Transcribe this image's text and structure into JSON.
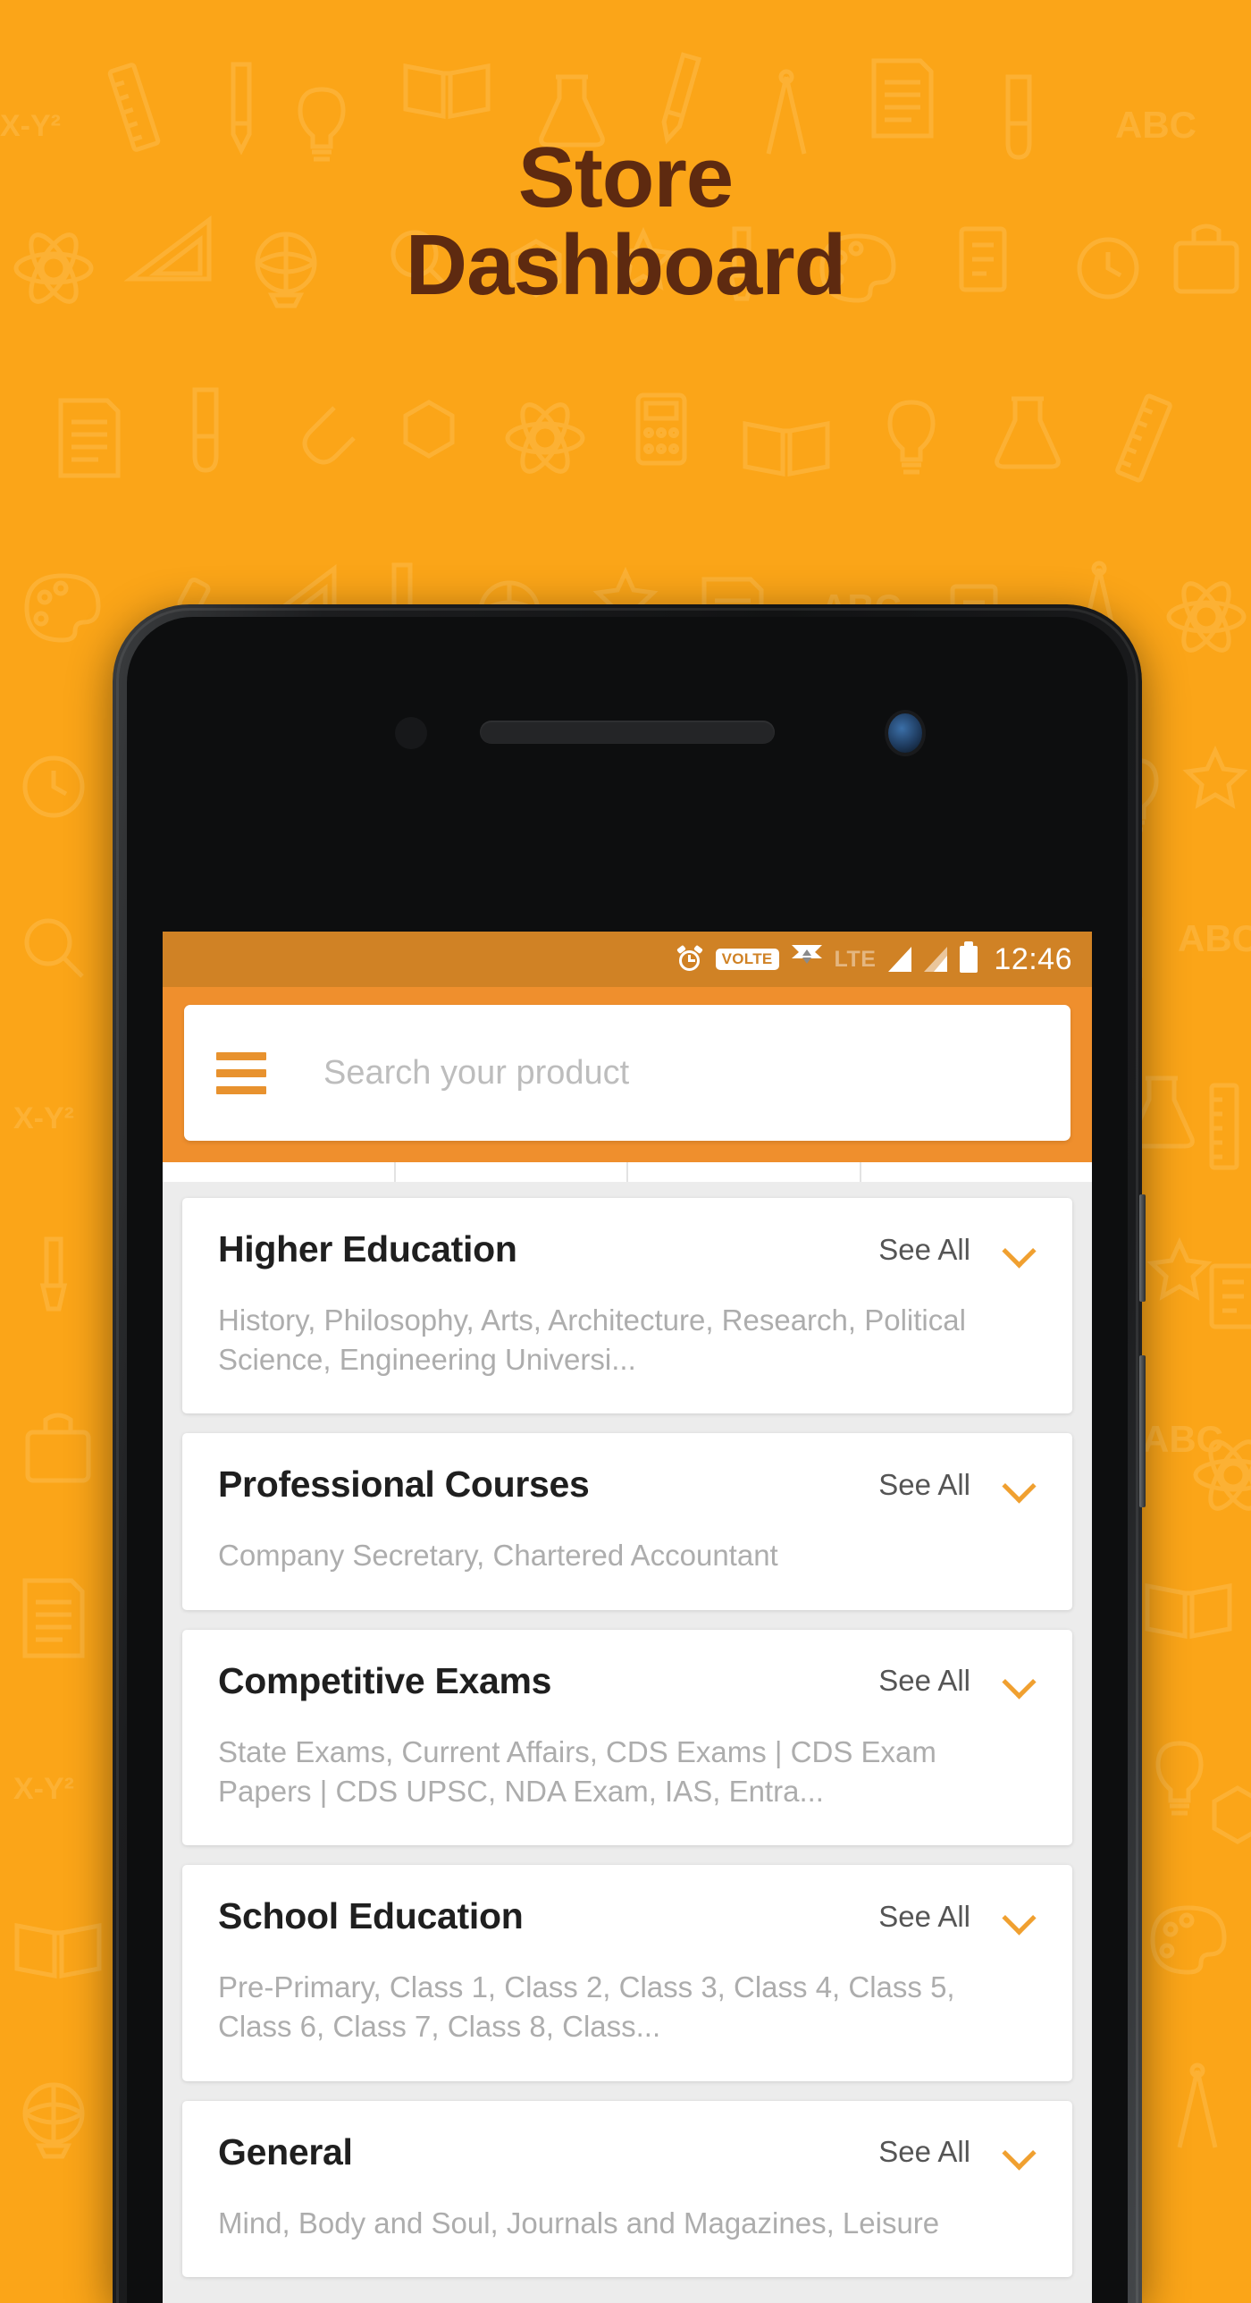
{
  "hero": {
    "line1": "Store",
    "line2": "Dashboard",
    "title_color": "#5E2A10",
    "background_color": "#FBA518"
  },
  "status_bar": {
    "alarm_icon": "alarm-clock-icon",
    "volte_label": "VOLTE",
    "data_sync_icon": "data-transfer-icon",
    "network_type": "LTE",
    "signal_icon_1": "signal-bars-full-icon",
    "signal_icon_2": "signal-bars-partial-icon",
    "battery_icon": "battery-full-icon",
    "time": "12:46",
    "background_color": "#D08225"
  },
  "toolbar": {
    "menu_icon": "hamburger-menu-icon",
    "search_placeholder": "Search your product",
    "background_color": "#EF8F2D",
    "accent_color": "#E8922E"
  },
  "tabstrip": {
    "tabs": [
      "",
      "",
      "",
      ""
    ]
  },
  "cards": [
    {
      "title": "Higher Education",
      "see_all_label": "See All",
      "expand_icon": "chevron-down-icon",
      "subtitle": "History, Philosophy, Arts, Architecture, Research, Political Science, Engineering Universi..."
    },
    {
      "title": "Professional Courses",
      "see_all_label": "See All",
      "expand_icon": "chevron-down-icon",
      "subtitle": "Company Secretary, Chartered Accountant"
    },
    {
      "title": "Competitive Exams",
      "see_all_label": "See All",
      "expand_icon": "chevron-down-icon",
      "subtitle": "State Exams, Current Affairs, CDS Exams | CDS Exam Papers | CDS UPSC, NDA Exam, IAS, Entra..."
    },
    {
      "title": "School Education",
      "see_all_label": "See All",
      "expand_icon": "chevron-down-icon",
      "subtitle": "Pre-Primary, Class 1, Class 2, Class 3, Class 4, Class 5, Class 6, Class 7, Class 8, Class..."
    },
    {
      "title": "General",
      "see_all_label": "See All",
      "expand_icon": "chevron-down-icon",
      "subtitle": "Mind, Body and Soul, Journals and Magazines, Leisure"
    }
  ]
}
